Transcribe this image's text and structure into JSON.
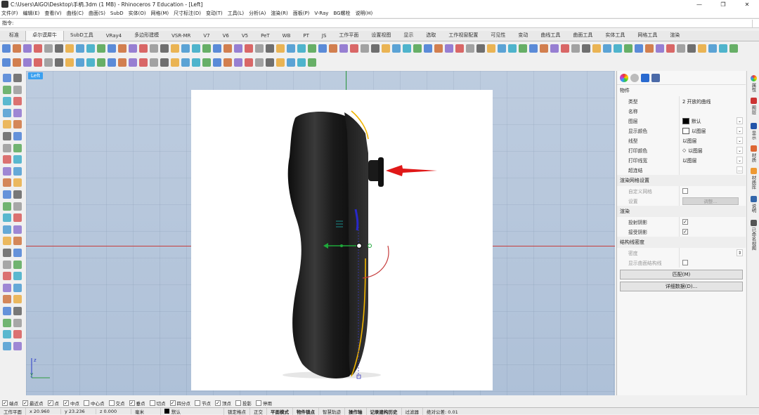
{
  "window": {
    "title": "C:\\Users\\AIGO\\Desktop\\手柄.3dm (1 MB) - Rhinoceros 7 Education - [Left]",
    "min": "—",
    "max": "❐",
    "close": "✕"
  },
  "menu": [
    "文件(F)",
    "编辑(E)",
    "查看(V)",
    "曲线(C)",
    "曲面(S)",
    "SubD",
    "实体(O)",
    "网格(M)",
    "尺寸标注(D)",
    "变动(T)",
    "工具(L)",
    "分析(A)",
    "渲染(R)",
    "面板(P)",
    "V-Ray",
    "BG螺栓",
    "说明(H)"
  ],
  "command": {
    "label": "指令:"
  },
  "tabs": [
    {
      "label": "标准",
      "active": false
    },
    {
      "label": "卓尔谟犀牛",
      "active": true
    },
    {
      "label": "SubD工具"
    },
    {
      "label": "VRay4"
    },
    {
      "label": "多边形建模"
    },
    {
      "label": "VSR-MR"
    },
    {
      "label": "V7"
    },
    {
      "label": "V6"
    },
    {
      "label": "V5"
    },
    {
      "label": "PeT"
    },
    {
      "label": "WB"
    },
    {
      "label": "PT"
    },
    {
      "label": "JS"
    },
    {
      "label": "工作平面"
    },
    {
      "label": "设置视图"
    },
    {
      "label": "显示"
    },
    {
      "label": "选取"
    },
    {
      "label": "工作视窗配置"
    },
    {
      "label": "可见性"
    },
    {
      "label": "变动"
    },
    {
      "label": "曲线工具"
    },
    {
      "label": "曲面工具"
    },
    {
      "label": "实体工具"
    },
    {
      "label": "网格工具"
    },
    {
      "label": "渲染"
    }
  ],
  "viewport": {
    "tab": "Left",
    "axis_z": "z",
    "axis_y": "y"
  },
  "properties": {
    "section_object": "物件",
    "rows": [
      {
        "k": "类型",
        "v": "2 开放的曲线"
      },
      {
        "k": "名称",
        "v": ""
      },
      {
        "k": "图层",
        "v": "默认",
        "swatch": "#000000",
        "drop": true
      },
      {
        "k": "显示颜色",
        "v": "以图层",
        "swatch": "#ffffff",
        "drop": true
      },
      {
        "k": "线型",
        "v": "以图层",
        "drop": true
      },
      {
        "k": "打印颜色",
        "v": "以图层",
        "diamond": true,
        "drop": true
      },
      {
        "k": "打印线宽",
        "v": "以图层",
        "drop": true
      },
      {
        "k": "超连结",
        "v": "",
        "more": true
      }
    ],
    "section_mesh": "渲染网格设置",
    "mesh_rows": [
      {
        "k": "自定义网格",
        "check": false
      },
      {
        "k": "设置",
        "button": "调整..."
      }
    ],
    "section_render": "渲染",
    "render_rows": [
      {
        "k": "投射阴影",
        "check": true
      },
      {
        "k": "接受阴影",
        "check": true
      }
    ],
    "section_iso": "结构线密度",
    "iso_rows": [
      {
        "k": "密度",
        "v": ""
      },
      {
        "k": "显示曲面结构线",
        "check": false
      }
    ],
    "match_button": "匹配(M)",
    "details_button": "详细数据(D)..."
  },
  "sidetabs": [
    "属性",
    "图层",
    "显示",
    "材质",
    "材质库",
    "说明",
    "已命名视图"
  ],
  "osnap": [
    {
      "label": "端点",
      "c": true
    },
    {
      "label": "最近点",
      "c": true
    },
    {
      "label": "点",
      "c": true
    },
    {
      "label": "中点",
      "c": true
    },
    {
      "label": "中心点",
      "c": false
    },
    {
      "label": "交点",
      "c": false
    },
    {
      "label": "垂点",
      "c": true
    },
    {
      "label": "切点",
      "c": false
    },
    {
      "label": "四分点",
      "c": true
    },
    {
      "label": "节点",
      "c": false
    },
    {
      "label": "顶点",
      "c": true
    },
    {
      "label": "投影",
      "c": false
    },
    {
      "label": "停用",
      "c": false
    }
  ],
  "status": {
    "cplane": "工作平面",
    "x": "x 20.960",
    "y": "y 23.236",
    "z": "z 0.000",
    "unit": "毫米",
    "layer": "默认",
    "toggles": [
      "锁定格点",
      "正交",
      "平面模式",
      "物件锁点",
      "智慧轨迹",
      "操作轴",
      "记录建构历史",
      "过滤器"
    ],
    "bold_toggles": [
      "平面模式",
      "物件锁点",
      "操作轴",
      "记录建构历史"
    ],
    "tolerance": "绝对公差: 0.01"
  },
  "colors": {
    "accent": "#3aa0f0",
    "xaxis": "#c63c3c",
    "yaxis": "#2c9b3e",
    "selection": "#f0b400"
  }
}
